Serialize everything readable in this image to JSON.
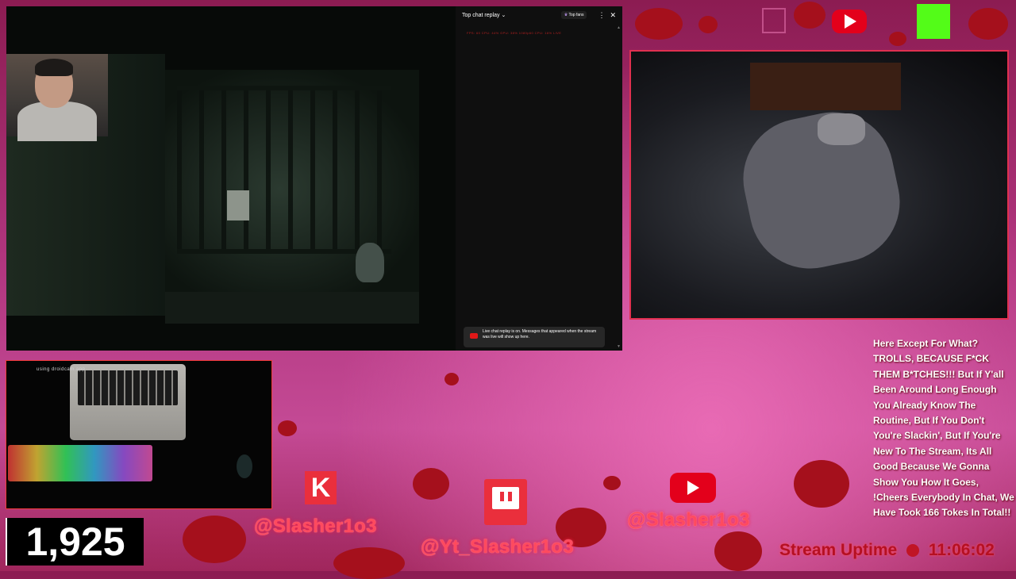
{
  "chat": {
    "title": "Top chat replay",
    "title_chevron": "⌄",
    "top_fans_label": "Top fans",
    "kebab_icon": "⋮",
    "close_icon": "✕",
    "overlay_text": "FPS: 60   CPU: 44% GPU: 38%   1080p60   CPU: 16%   LIVE",
    "notice": "Live chat replay is on. Messages that appeared when the stream was live will show up here."
  },
  "deskcam": {
    "overlay_text": "using droidcam.app"
  },
  "counter": {
    "value": "1,925"
  },
  "socials": {
    "kick_handle": "@Slasher1o3",
    "twitch_handle": "@Yt_Slasher1o3",
    "youtube_handle": "@Slasher1o3"
  },
  "ticker": {
    "text": "Here Except For What? TROLLS, BECAUSE F*CK THEM B*TCHES!!! But If Y'all Been Around Long Enough You Already Know The Routine, But If You Don't You're Slackin', But If You're New To The Stream, Its All Good Because We Gonna Show You How It Goes, !Cheers Everybody In Chat, We Have Took 166 Tokes In Total!!"
  },
  "uptime": {
    "label": "Stream Uptime",
    "time": "11:06:02"
  },
  "colors": {
    "accent": "#ea2f3c",
    "kick": "#53fc18",
    "youtube": "#e3001b"
  },
  "icons": [
    "youtube-icon",
    "kick-icon",
    "twitch-icon"
  ]
}
